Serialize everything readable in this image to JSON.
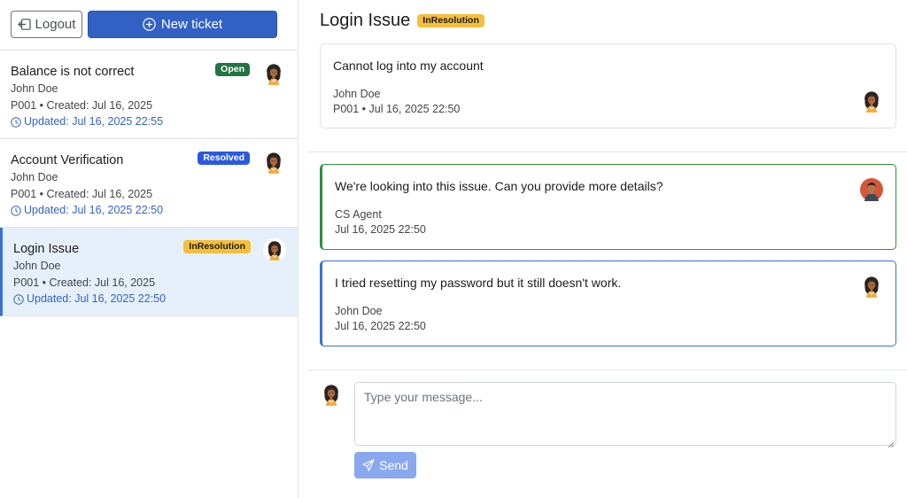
{
  "sidebar": {
    "logout_label": "Logout",
    "new_ticket_label": "New ticket",
    "tickets": [
      {
        "title": "Balance is not correct",
        "customer": "John Doe",
        "meta": "P001 • Created: Jul 16, 2025",
        "updated": "Updated: Jul 16, 2025 22:55",
        "status": "Open"
      },
      {
        "title": "Account Verification",
        "customer": "John Doe",
        "meta": "P001 • Created: Jul 16, 2025",
        "updated": "Updated: Jul 16, 2025 22:50",
        "status": "Resolved"
      },
      {
        "title": "Login Issue",
        "customer": "John Doe",
        "meta": "P001 • Created: Jul 16, 2025",
        "updated": "Updated: Jul 16, 2025 22:50",
        "status": "InResolution"
      }
    ]
  },
  "main": {
    "title": "Login Issue",
    "status": "InResolution",
    "description": {
      "text": "Cannot log into my account",
      "author": "John Doe",
      "meta": "P001 • Jul 16, 2025 22:50"
    },
    "messages": [
      {
        "text": "We're looking into this issue. Can you provide more details?",
        "author": "CS Agent",
        "date": "Jul 16, 2025 22:50"
      },
      {
        "text": "I tried resetting my password but it still doesn't work.",
        "author": "John Doe",
        "date": "Jul 16, 2025 22:50"
      }
    ],
    "composer": {
      "placeholder": "Type your message...",
      "send_label": "Send"
    }
  },
  "colors": {
    "primary": "#3161c4",
    "status_open": "#237443",
    "status_resolved": "#2b58e0",
    "status_inresolution": "#f4bf3b",
    "agent_border": "#2f8f3a",
    "user_border": "#3a6fd8",
    "selected_bg": "#e5f0fb"
  },
  "icons": {
    "logout": "box-arrow-left-icon",
    "new_ticket": "plus-circle-icon",
    "updated": "clock-icon",
    "send": "paper-plane-icon"
  }
}
